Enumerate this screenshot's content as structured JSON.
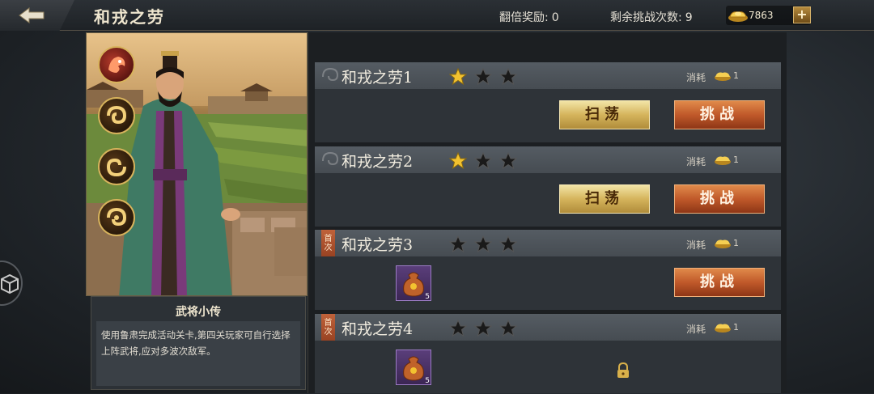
{
  "header": {
    "title": "和戎之劳",
    "double_reward_label": "翻倍奖励:",
    "double_reward_value": "0",
    "remaining_label": "剩余挑战次数:",
    "remaining_value": "9",
    "currency_amount": "7863",
    "plus_label": "+"
  },
  "bio": {
    "title": "武将小传",
    "text": "使用鲁肃完成活动关卡,第四关玩家可自行选择上阵武将,应对多波次敌军。"
  },
  "stages": [
    {
      "name": "和戎之劳1",
      "stars_earned": 1,
      "stars_total": 3,
      "cost_label": "消耗",
      "cost_value": "1",
      "sweep_label": "扫荡",
      "fight_label": "挑战"
    },
    {
      "name": "和戎之劳2",
      "stars_earned": 1,
      "stars_total": 3,
      "cost_label": "消耗",
      "cost_value": "1",
      "sweep_label": "扫荡",
      "fight_label": "挑战"
    },
    {
      "name": "和戎之劳3",
      "stars_earned": 0,
      "stars_total": 3,
      "cost_label": "消耗",
      "cost_value": "1",
      "first_tag": "首次",
      "reward_count": "5",
      "fight_label": "挑战"
    },
    {
      "name": "和戎之劳4",
      "stars_earned": 0,
      "stars_total": 3,
      "cost_label": "消耗",
      "cost_value": "1",
      "first_tag": "首次",
      "reward_count": "5",
      "locked": true
    }
  ],
  "icons": {
    "back": "back-arrow-icon",
    "currency": "gold-ingot-icon",
    "star": "star-icon",
    "reward": "money-bag-icon",
    "lock": "lock-icon"
  },
  "colors": {
    "star_gold": "#f2c230",
    "star_empty": "#1a1a1a",
    "fight_button": "#c0592a",
    "sweep_button": "#d5b45c"
  }
}
